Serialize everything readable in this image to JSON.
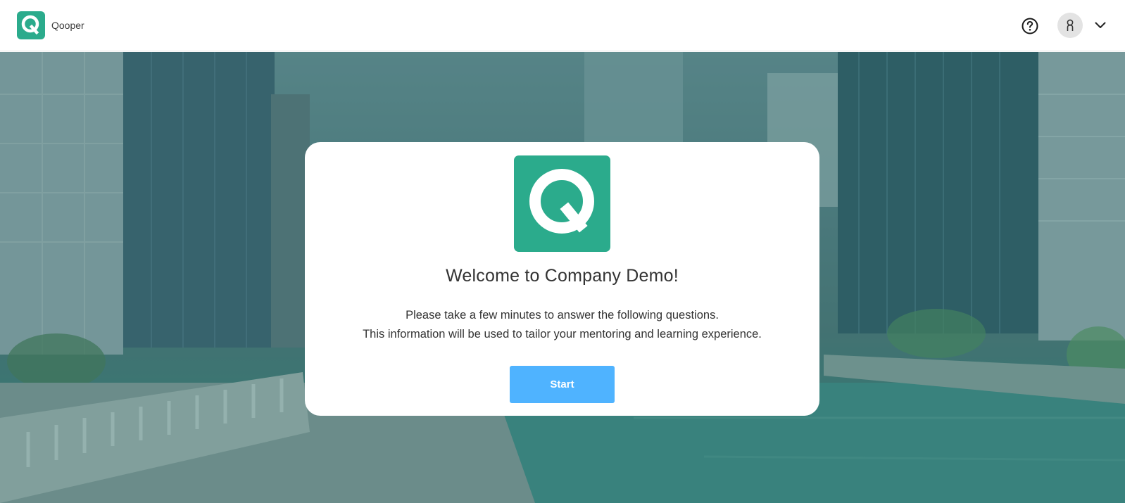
{
  "header": {
    "brand_name": "Qooper",
    "help_icon": "question-circle-icon",
    "avatar_icon": "user-icon",
    "menu_icon": "chevron-down-icon"
  },
  "welcome": {
    "title": "Welcome to Company Demo!",
    "line1": "Please take a few minutes to answer the following questions.",
    "line2": "This information will be used to tailor your mentoring and learning experience.",
    "start_label": "Start"
  },
  "colors": {
    "brand": "#2bab8c",
    "button": "#4fb3ff",
    "overlay": "#2f6f6f"
  }
}
